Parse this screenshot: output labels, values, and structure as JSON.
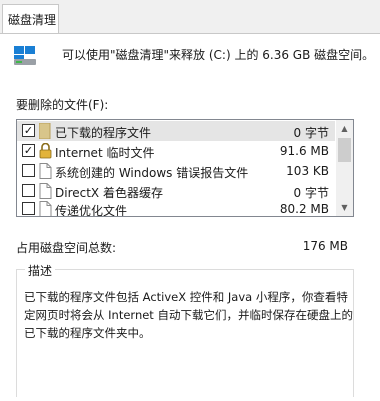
{
  "tab": {
    "label": "磁盘清理"
  },
  "header": {
    "text": "可以使用\"磁盘清理\"来释放 (C:) 上的 6.36 GB 磁盘空间。",
    "icon": "drive-cleanup-icon"
  },
  "files_section": {
    "label": "要删除的文件(F):",
    "items": [
      {
        "label": "已下载的程序文件",
        "size": "0 字节",
        "checked": true,
        "icon": "folder-icon",
        "selected": true
      },
      {
        "label": "Internet 临时文件",
        "size": "91.6 MB",
        "checked": true,
        "icon": "lock-icon",
        "selected": false
      },
      {
        "label": "系统创建的 Windows 错误报告文件",
        "size": "103 KB",
        "checked": false,
        "icon": "file-icon",
        "selected": false
      },
      {
        "label": "DirectX 着色器缓存",
        "size": "0 字节",
        "checked": false,
        "icon": "file-icon",
        "selected": false
      },
      {
        "label": "传递优化文件",
        "size": "80.2 MB",
        "checked": false,
        "icon": "file-icon",
        "selected": false
      }
    ]
  },
  "total": {
    "label": "占用磁盘空间总数:",
    "value": "176 MB"
  },
  "description": {
    "title": "描述",
    "text": "已下载的程序文件包括 ActiveX 控件和 Java 小程序，你查看特定网页时将会从 Internet 自动下载它们，并临时保存在硬盘上的已下载的程序文件夹中。"
  },
  "colors": {
    "selection": "#e5e5e5",
    "folder": "#d8c58a"
  }
}
